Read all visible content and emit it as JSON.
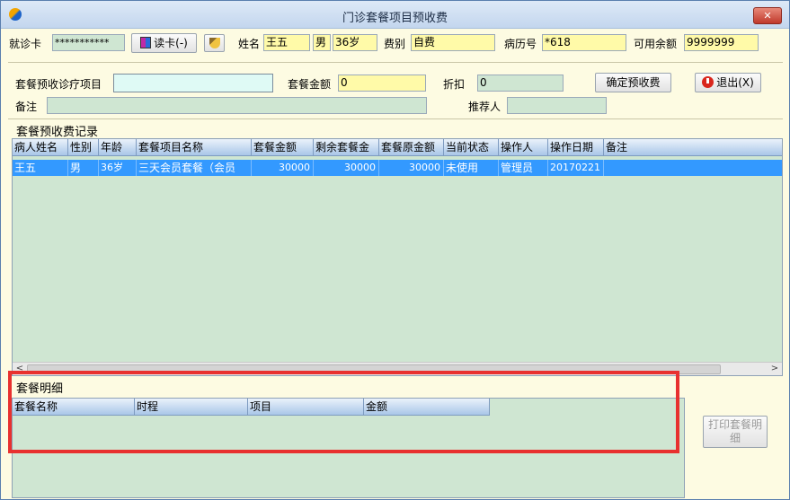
{
  "window": {
    "title": "门诊套餐项目预收费"
  },
  "form": {
    "card_label": "就诊卡",
    "card_value": "***********",
    "read_card_label": "读卡(-)",
    "name_label": "姓名",
    "name_value": "王五",
    "gender_value": "男",
    "age_value": "36岁",
    "fee_type_label": "费别",
    "fee_type_value": "自费",
    "record_label": "病历号",
    "record_value": "*618",
    "balance_label": "可用余额",
    "balance_value": "9999999",
    "package_item_label": "套餐预收诊疗项目",
    "package_item_value": "",
    "amount_label": "套餐金额",
    "amount_value": "0",
    "discount_label": "折扣",
    "discount_value": "0",
    "confirm_label": "确定预收费",
    "exit_label": "退出(X)",
    "remark_label": "备注",
    "remark_value": "",
    "referrer_label": "推荐人",
    "referrer_value": ""
  },
  "records": {
    "section_label": "套餐预收费记录",
    "columns": [
      "病人姓名",
      "性别",
      "年龄",
      "套餐项目名称",
      "套餐金额",
      "剩余套餐金",
      "套餐原金额",
      "当前状态",
      "操作人",
      "操作日期",
      "备注"
    ],
    "rows": [
      [
        "王五",
        "男",
        "36岁",
        "三天会员套餐（会员",
        "30000",
        "30000",
        "30000",
        "未使用",
        "管理员",
        "20170221",
        ""
      ]
    ]
  },
  "details": {
    "section_label": "套餐明细",
    "columns": [
      "套餐名称",
      "时程",
      "项目",
      "金额"
    ],
    "print_label": "打印套餐明细"
  },
  "colors": {
    "accent": "#3399ff",
    "highlight_box": "#e8312f",
    "field_yellow": "#fffaa8",
    "field_green": "#cfe6d2"
  }
}
